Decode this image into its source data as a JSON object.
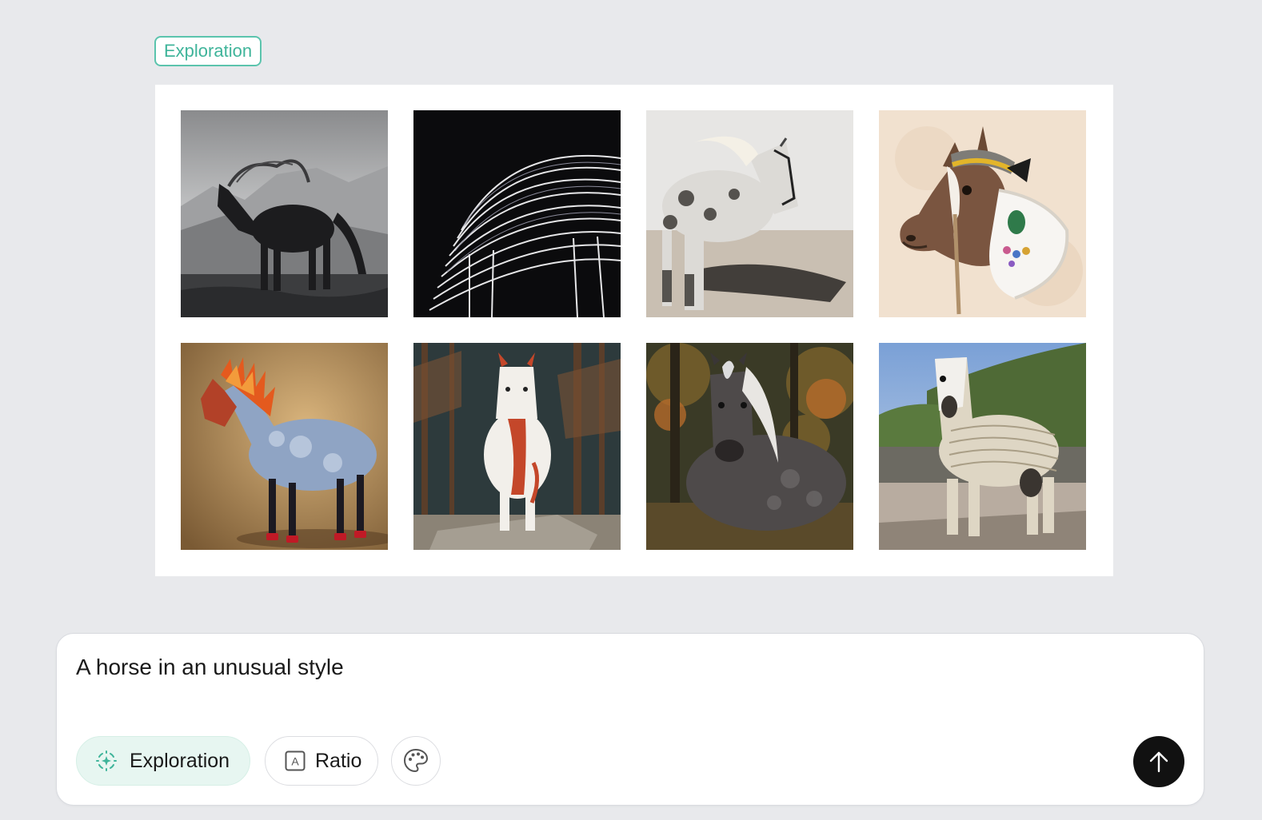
{
  "header": {
    "mode_tag": "Exploration"
  },
  "gallery": {
    "images": [
      {
        "subject": "black horse with windswept mane in misty rain"
      },
      {
        "subject": "horse made of wavy white contour lines on black"
      },
      {
        "subject": "dappled grey horse with halter against white wall"
      },
      {
        "subject": "illustrated horse head with cap, bow and jeweled collar"
      },
      {
        "subject": "horse with flaming red mane and iridescent blue coat"
      },
      {
        "subject": "white and red painted horse in pine forest"
      },
      {
        "subject": "dapple grey horse with long silver mane in autumn woods"
      },
      {
        "subject": "pinto horse wrapped in cream bandages on country road"
      }
    ]
  },
  "composer": {
    "prompt_value": "A horse in an unusual style",
    "exploration_label": "Exploration",
    "ratio_label": "Ratio",
    "ratio_icon_letter": "A",
    "icons": {
      "exploration": "sparkle-focus-icon",
      "ratio": "aspect-ratio-icon",
      "palette": "palette-icon",
      "send": "arrow-up-icon"
    },
    "accent_color": "#3fb49a",
    "send_color": "#111111"
  }
}
